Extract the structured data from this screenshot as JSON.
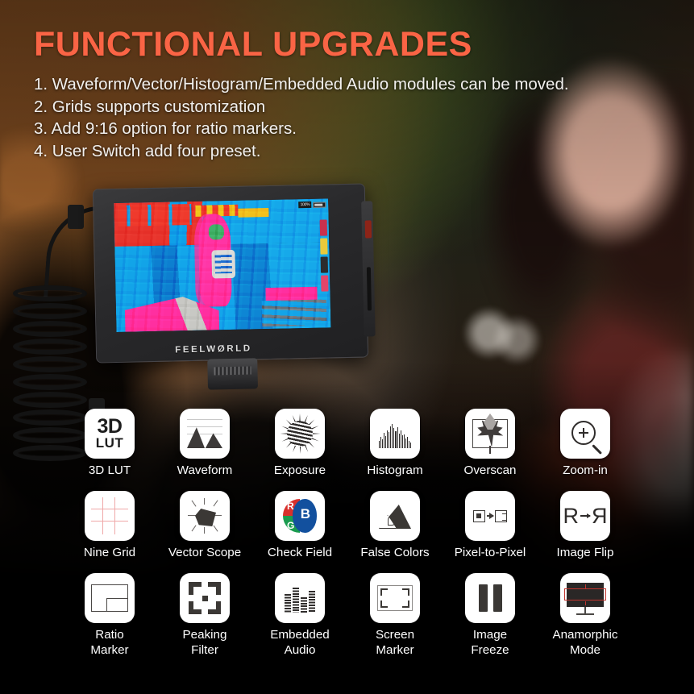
{
  "header": {
    "title": "FUNCTIONAL UPGRADES",
    "bullets": [
      "1. Waveform/Vector/Histogram/Embedded Audio modules can be moved.",
      "2. Grids supports customization",
      "3. Add 9:16 option for ratio markers.",
      "4. User Switch add four preset."
    ]
  },
  "monitor": {
    "brand": "FEELWØRLD",
    "osd": {
      "percent": "100%",
      "battery_icon": "battery-icon"
    }
  },
  "icons": {
    "row1": [
      {
        "label": "3D LUT",
        "icon": "3d-lut-icon",
        "glyph_top": "3D",
        "glyph_bottom": "LUT"
      },
      {
        "label": "Waveform",
        "icon": "waveform-icon"
      },
      {
        "label": "Exposure",
        "icon": "exposure-icon"
      },
      {
        "label": "Histogram",
        "icon": "histogram-icon"
      },
      {
        "label": "Overscan",
        "icon": "overscan-leaf-icon"
      },
      {
        "label": "Zoom-in",
        "icon": "zoom-in-icon"
      }
    ],
    "row2": [
      {
        "label": "Nine Grid",
        "icon": "nine-grid-icon"
      },
      {
        "label": "Vector Scope",
        "icon": "vector-scope-icon"
      },
      {
        "label": "Check Field",
        "icon": "check-field-rgb-icon",
        "glyph_r": "R",
        "glyph_g": "G",
        "glyph_b": "B"
      },
      {
        "label": "False Colors",
        "icon": "false-colors-icon"
      },
      {
        "label": "Pixel-to-Pixel",
        "icon": "pixel-to-pixel-icon"
      },
      {
        "label": "Image Flip",
        "icon": "image-flip-icon",
        "glyph_left": "R",
        "glyph_right": "R"
      }
    ],
    "row3": [
      {
        "label": "Ratio\nMarker",
        "line1": "Ratio",
        "line2": "Marker",
        "icon": "ratio-marker-icon"
      },
      {
        "label": "Peaking\nFilter",
        "line1": "Peaking",
        "line2": "Filter",
        "icon": "peaking-filter-icon"
      },
      {
        "label": "Embedded\nAudio",
        "line1": "Embedded",
        "line2": "Audio",
        "icon": "embedded-audio-icon"
      },
      {
        "label": "Screen\nMarker",
        "line1": "Screen",
        "line2": "Marker",
        "icon": "screen-marker-icon"
      },
      {
        "label": "Image\nFreeze",
        "line1": "Image",
        "line2": "Freeze",
        "icon": "image-freeze-icon"
      },
      {
        "label": "Anamorphic\nMode",
        "line1": "Anamorphic",
        "line2": "Mode",
        "icon": "anamorphic-mode-icon"
      }
    ]
  },
  "colors": {
    "title": "#FA6445",
    "body_text": "#F2F0EE",
    "tile_bg": "#FFFFFF",
    "icon_dark": "#3B3835",
    "check_red": "#D8302C",
    "check_green": "#1A9C4F",
    "check_blue": "#12509E",
    "grid_pink": "#F0A8A8",
    "anamorphic_red": "#C0352F",
    "panel_bg": "#000000"
  }
}
